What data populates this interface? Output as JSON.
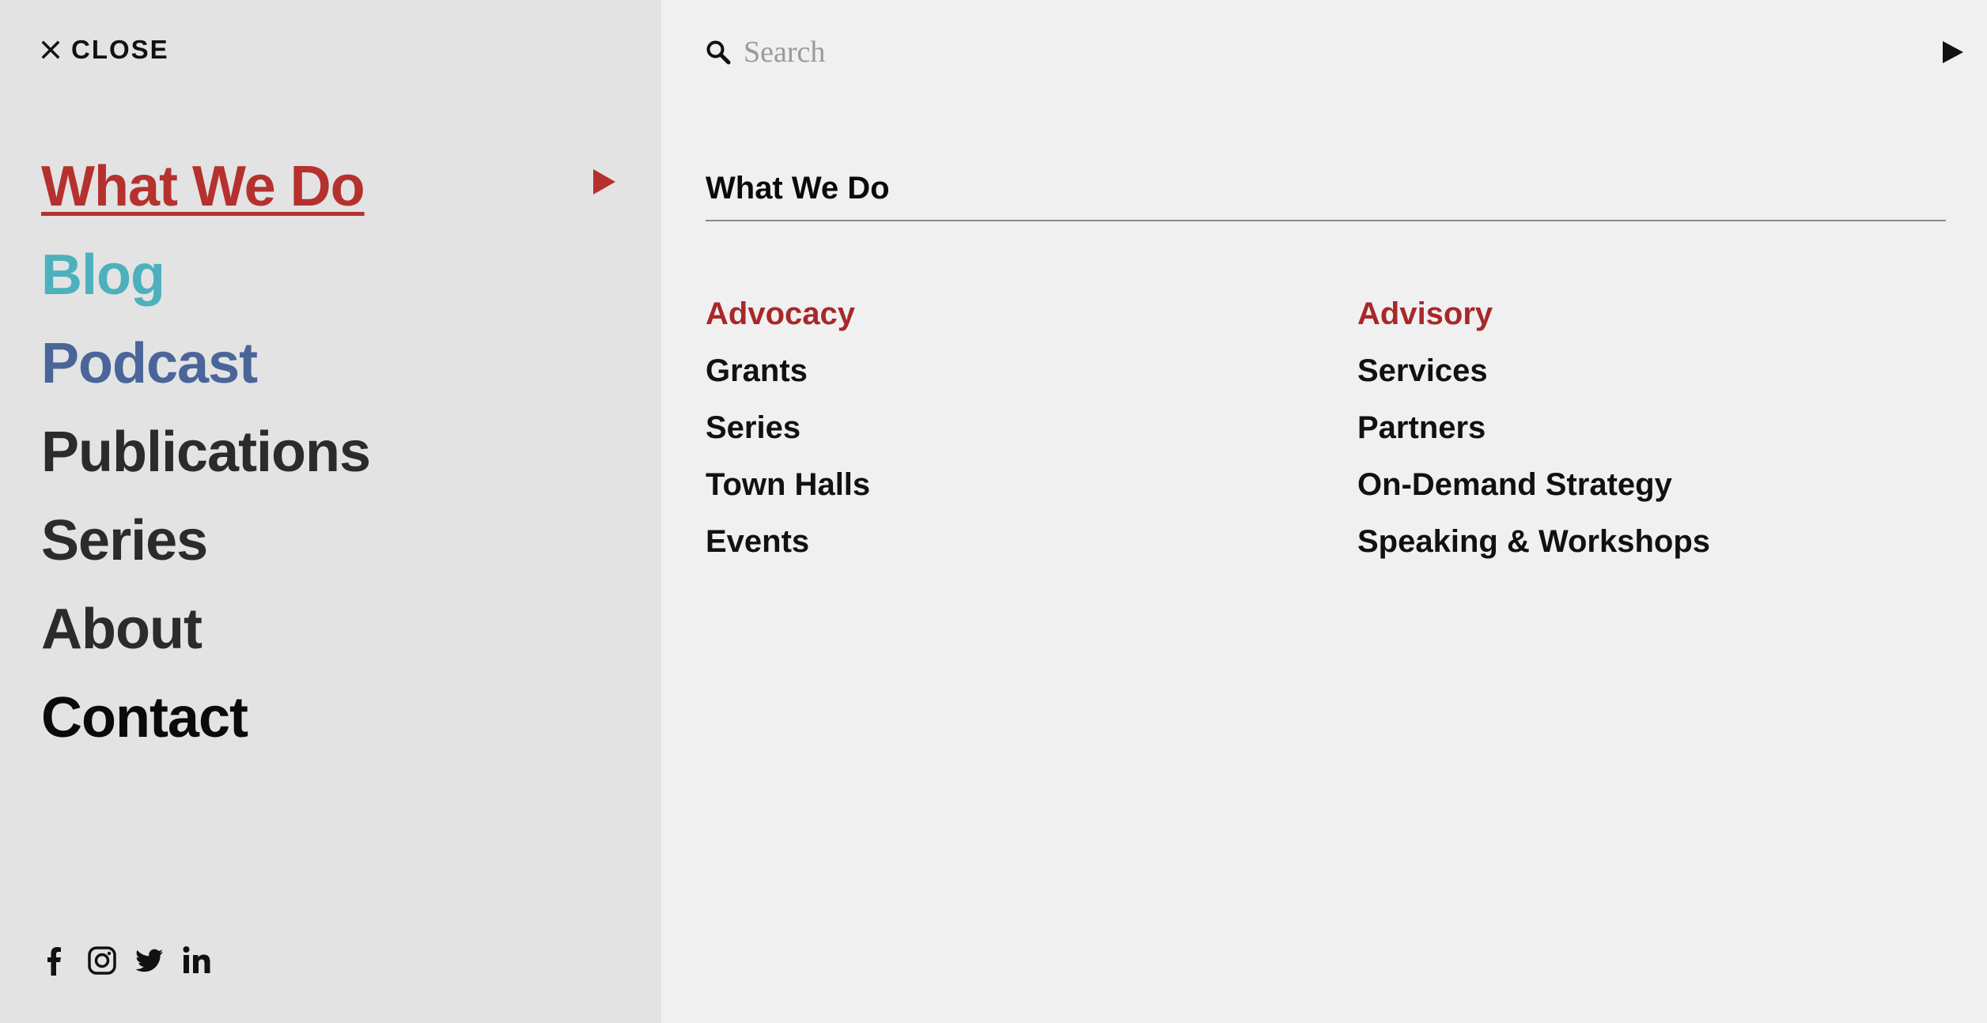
{
  "close": {
    "label": "CLOSE",
    "icon": "close-icon"
  },
  "main_nav": {
    "items": [
      {
        "label": "What We Do",
        "color": "#b5312e",
        "active": true
      },
      {
        "label": "Blog",
        "color": "#4db1bd"
      },
      {
        "label": "Podcast",
        "color": "#4a6599"
      },
      {
        "label": "Publications",
        "color": "#2b2b2b"
      },
      {
        "label": "Series",
        "color": "#2b2b2b"
      },
      {
        "label": "About",
        "color": "#2b2b2b"
      },
      {
        "label": "Contact",
        "color": "#0a0a0a"
      }
    ],
    "arrow_icon": "play-arrow-icon",
    "arrow_color": "#b5312e"
  },
  "social": [
    {
      "icon": "facebook-icon"
    },
    {
      "icon": "instagram-icon"
    },
    {
      "icon": "twitter-icon"
    },
    {
      "icon": "linkedin-icon"
    }
  ],
  "search": {
    "placeholder": "Search",
    "value": "",
    "icon": "search-icon",
    "submit_icon": "play-arrow-icon"
  },
  "panel": {
    "title": "What We Do",
    "columns": [
      {
        "heading": "Advocacy",
        "links": [
          "Grants",
          "Series",
          "Town Halls",
          "Events"
        ]
      },
      {
        "heading": "Advisory",
        "links": [
          "Services",
          "Partners",
          "On-Demand Strategy",
          "Speaking & Workshops"
        ]
      }
    ]
  },
  "colors": {
    "accent": "#b5312e",
    "heading_red": "#a8282a",
    "left_bg": "#e3e3e3",
    "right_bg": "#f0f0f0"
  }
}
